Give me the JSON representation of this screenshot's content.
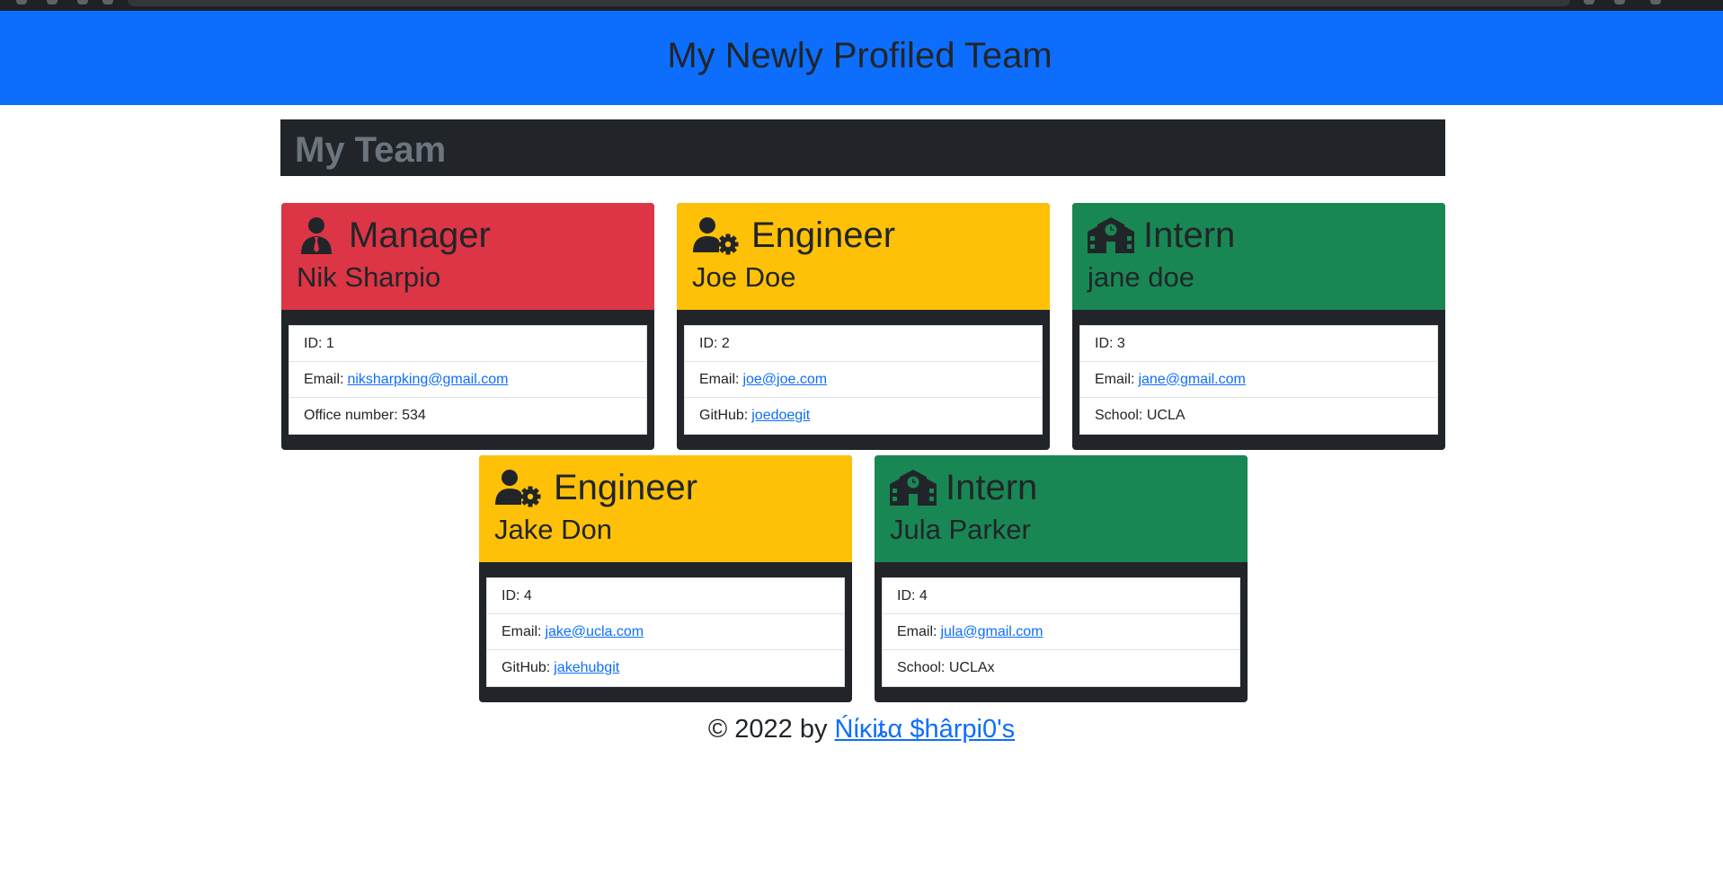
{
  "header": {
    "title": "My Newly Profiled Team"
  },
  "team_bar": {
    "title": "My Team"
  },
  "colors": {
    "header_bg": "#0d6efd",
    "manager": "#dc3545",
    "engineer": "#ffc107",
    "intern": "#198754",
    "dark": "#212529",
    "link": "#0d6efd"
  },
  "cards": [
    {
      "role": "Manager",
      "icon": "user-tie-icon",
      "name": "Nik Sharpio",
      "id_label": "ID:",
      "id_value": "1",
      "email_label": "Email:",
      "email": "niksharpking@gmail.com",
      "extra_label": "Office number:",
      "extra_value": "534"
    },
    {
      "role": "Engineer",
      "icon": "user-gear-icon",
      "name": "Joe Doe",
      "id_label": "ID:",
      "id_value": "2",
      "email_label": "Email:",
      "email": "joe@joe.com",
      "extra_label": "GitHub:",
      "extra_value": "joedoegit"
    },
    {
      "role": "Intern",
      "icon": "school-icon",
      "name": "jane doe",
      "id_label": "ID:",
      "id_value": "3",
      "email_label": "Email:",
      "email": "jane@gmail.com",
      "extra_label": "School:",
      "extra_value": "UCLA"
    },
    {
      "role": "Engineer",
      "icon": "user-gear-icon",
      "name": "Jake Don",
      "id_label": "ID:",
      "id_value": "4",
      "email_label": "Email:",
      "email": "jake@ucla.com",
      "extra_label": "GitHub:",
      "extra_value": "jakehubgit"
    },
    {
      "role": "Intern",
      "icon": "school-icon",
      "name": "Jula Parker",
      "id_label": "ID:",
      "id_value": "4",
      "email_label": "Email:",
      "email": "jula@gmail.com",
      "extra_label": "School:",
      "extra_value": "UCLAx"
    }
  ],
  "footer": {
    "prefix": "© 2022 by ",
    "author": "Ńίκiȶα $hârpi0's"
  }
}
